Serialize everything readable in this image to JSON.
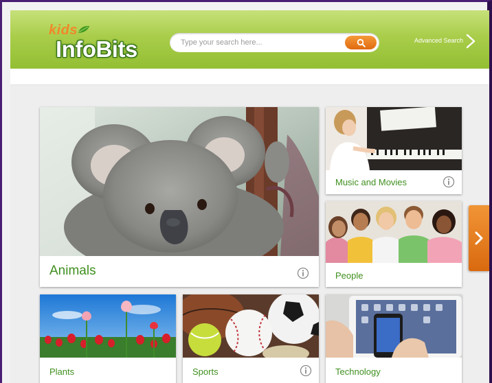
{
  "header": {
    "logo_kids": "kids",
    "logo_name": "InfoBits",
    "search_placeholder": "Type your search here...",
    "advanced_search_label": "Advanced Search"
  },
  "tiles": {
    "animals": {
      "label": "Animals",
      "image": "koala-photo"
    },
    "music": {
      "label": "Music and Movies",
      "image": "girl-playing-piano-photo"
    },
    "people": {
      "label": "People",
      "image": "group-of-children-photo"
    },
    "plants": {
      "label": "Plants",
      "image": "tulip-field-photo"
    },
    "sports": {
      "label": "Sports",
      "image": "sports-balls-photo"
    },
    "technology": {
      "label": "Technology",
      "image": "tablet-and-phone-photo"
    }
  },
  "icons": {
    "search": "search-icon",
    "info": "info-icon",
    "next": "chevron-right-icon"
  },
  "colors": {
    "header_green": "#a9cd4a",
    "accent_orange": "#e97a1c",
    "label_green": "#3f8f1f",
    "frame_purple": "#4a1f72"
  }
}
